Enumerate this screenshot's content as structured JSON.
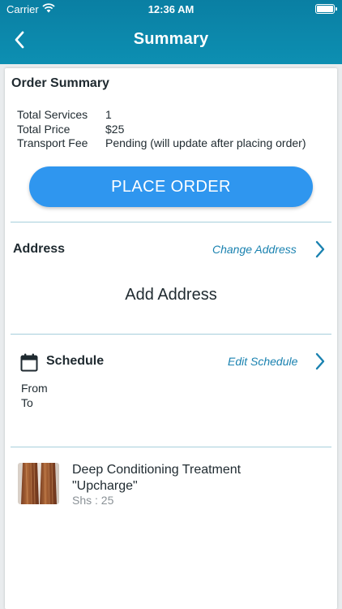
{
  "status_bar": {
    "carrier": "Carrier",
    "time": "12:36 AM"
  },
  "nav": {
    "title": "Summary",
    "back_icon": "chevron-left-icon"
  },
  "order_summary": {
    "title": "Order Summary",
    "rows": [
      {
        "label": "Total Services",
        "value": "1"
      },
      {
        "label": "Total Price",
        "value": "$25"
      },
      {
        "label": "Transport Fee",
        "value": "Pending (will update after placing order)"
      }
    ],
    "place_order_label": "PLACE ORDER"
  },
  "address": {
    "title": "Address",
    "change_label": "Change Address",
    "add_label": "Add Address"
  },
  "schedule": {
    "title": "Schedule",
    "edit_label": "Edit Schedule",
    "from_label": "From",
    "to_label": "To"
  },
  "services": [
    {
      "name_line1": "Deep Conditioning Treatment",
      "name_line2": "\"Upcharge\"",
      "price": "Shs : 25"
    }
  ],
  "colors": {
    "header": "#0d8fb2",
    "button": "#2f96ef",
    "link": "#1a82b0",
    "divider": "#a7cfdc"
  }
}
